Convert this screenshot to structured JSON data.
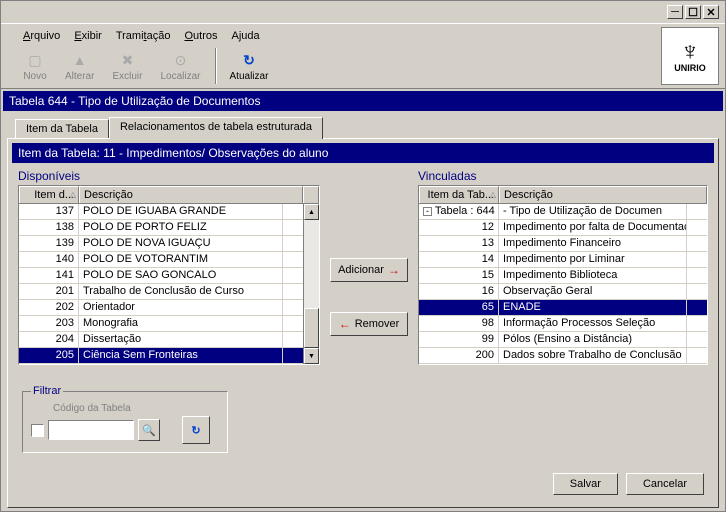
{
  "window": {
    "minimize": "_",
    "maximize": "□",
    "close": "×"
  },
  "menu": {
    "arquivo": "Arquivo",
    "exibir": "Exibir",
    "tramitacao": "Tramitação",
    "outros": "Outros",
    "ajuda": "Ajuda"
  },
  "toolbar": {
    "novo": "Novo",
    "alterar": "Alterar",
    "excluir": "Excluir",
    "localizar": "Localizar",
    "atualizar": "Atualizar"
  },
  "logo": {
    "text": "UNIRIO"
  },
  "header_title": "Tabela 644 - Tipo de Utilização de Documentos",
  "tabs": {
    "item": "Item da Tabela",
    "relacionamentos": "Relacionamentos de tabela estruturada"
  },
  "section_title": "Item da Tabela: 11 - Impedimentos/ Observações do aluno",
  "disponiveis": {
    "label": "Disponíveis",
    "col_id": "Item d...",
    "col_desc": "Descrição",
    "rows": [
      {
        "id": "137",
        "desc": "POLO DE IGUABA GRANDE"
      },
      {
        "id": "138",
        "desc": "POLO DE PORTO FELIZ"
      },
      {
        "id": "139",
        "desc": "POLO DE NOVA IGUAÇU"
      },
      {
        "id": "140",
        "desc": "POLO DE VOTORANTIM"
      },
      {
        "id": "141",
        "desc": "POLO DE SAO GONCALO"
      },
      {
        "id": "201",
        "desc": "Trabalho de Conclusão de Curso"
      },
      {
        "id": "202",
        "desc": "Orientador"
      },
      {
        "id": "203",
        "desc": "Monografia"
      },
      {
        "id": "204",
        "desc": "Dissertação"
      },
      {
        "id": "205",
        "desc": "Ciência Sem Fronteiras"
      }
    ],
    "selected_index": 9
  },
  "vinculadas": {
    "label": "Vinculadas",
    "col_id": "Item da Tab...",
    "col_desc": "Descrição",
    "group": {
      "label": "Tabela : 644",
      "desc": "- Tipo de Utilização de Documen"
    },
    "rows": [
      {
        "id": "12",
        "desc": "Impedimento por falta de Documentação"
      },
      {
        "id": "13",
        "desc": "Impedimento Financeiro"
      },
      {
        "id": "14",
        "desc": "Impedimento por Liminar"
      },
      {
        "id": "15",
        "desc": "Impedimento Biblioteca"
      },
      {
        "id": "16",
        "desc": "Observação Geral"
      },
      {
        "id": "65",
        "desc": "ENADE"
      },
      {
        "id": "98",
        "desc": "Informação Processos Seleção"
      },
      {
        "id": "99",
        "desc": "Pólos (Ensino a Distância)"
      },
      {
        "id": "200",
        "desc": "Dados sobre Trabalho de Conclusão"
      }
    ],
    "selected_index": 5
  },
  "buttons": {
    "adicionar": "Adicionar",
    "remover": "Remover",
    "salvar": "Salvar",
    "cancelar": "Cancelar"
  },
  "filter": {
    "legend": "Filtrar",
    "field_label": "Código da Tabela"
  }
}
